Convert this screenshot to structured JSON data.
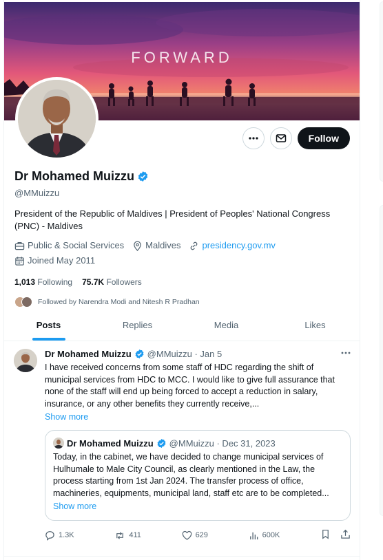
{
  "banner": {
    "text": "FORWARD"
  },
  "actions": {
    "follow_label": "Follow"
  },
  "profile": {
    "name": "Dr Mohamed Muizzu",
    "handle": "@MMuizzu",
    "bio": "President of the Republic of Maldives | President of Peoples' National Congress (PNC) - Maldives",
    "category": "Public & Social Services",
    "location": "Maldives",
    "website": "presidency.gov.mv",
    "joined": "Joined May 2011",
    "following_count": "1,013",
    "following_label": "Following",
    "followers_count": "75.7K",
    "followers_label": "Followers",
    "followed_by": "Followed by Narendra Modi and Nitesh R Pradhan"
  },
  "tabs": [
    "Posts",
    "Replies",
    "Media",
    "Likes"
  ],
  "tweet": {
    "name": "Dr Mohamed Muizzu",
    "handle_date": "@MMuizzu · Jan 5",
    "text": "I have received concerns from some staff of HDC regarding the shift of municipal services from HDC to MCC. I would like to give full assurance that none of the staff will end up being forced to accept a reduction in salary, insurance, or any other benefits they currently receive,...",
    "show_more": "Show more",
    "quote": {
      "name": "Dr Mohamed Muizzu",
      "handle_date": "@MMuizzu · Dec 31, 2023",
      "text": "Today, in the cabinet, we have decided to change municipal services of Hulhumale to Male City Council, as clearly mentioned in the Law, the process starting from 1st Jan 2024. The transfer process of office, machineries, equipments, municipal land, staff etc are to be completed...",
      "show_more": "Show more"
    },
    "stats": {
      "replies": "1.3K",
      "reposts": "411",
      "likes": "629",
      "views": "600K"
    }
  },
  "colors": {
    "accent": "#1d9bf0",
    "text": "#0f1419",
    "muted": "#536471",
    "border": "#cfd9de"
  }
}
